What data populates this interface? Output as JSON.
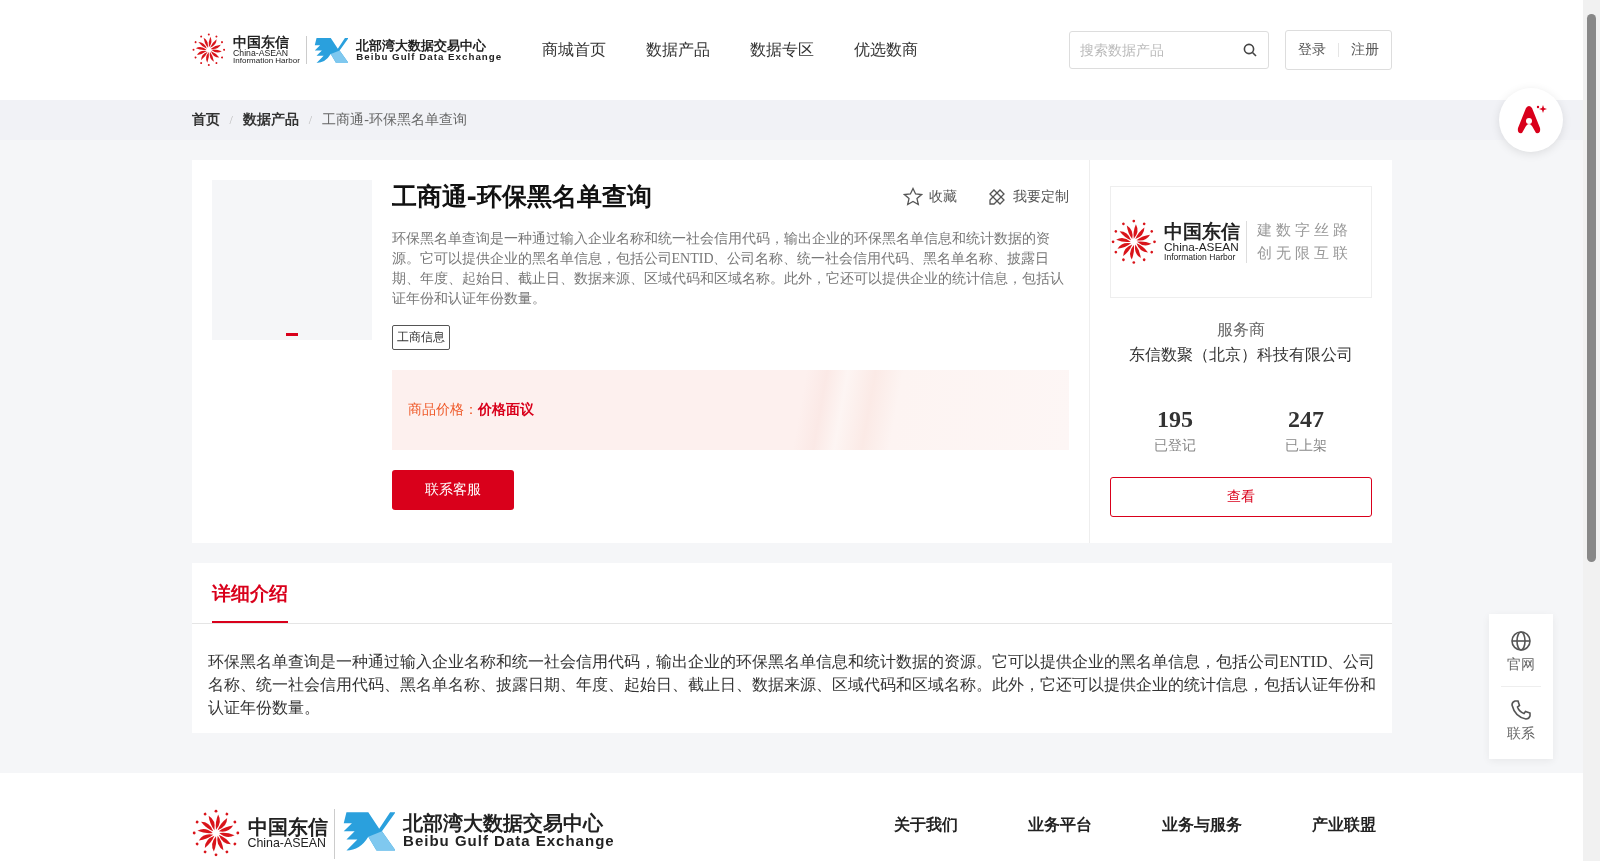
{
  "header": {
    "brand": {
      "cn": "中国东信",
      "en": "China-ASEAN",
      "en2": "Information Harbor"
    },
    "exchange": {
      "cn": "北部湾大数据交易中心",
      "en": "Beibu Gulf Data Exchange"
    },
    "nav": [
      {
        "label": "商城首页",
        "selected": false
      },
      {
        "label": "数据产品",
        "selected": false
      },
      {
        "label": "数据专区",
        "selected": false
      },
      {
        "label": "优选数商",
        "selected": false
      }
    ],
    "search": {
      "placeholder": "搜索数据产品"
    },
    "auth": [
      "登录",
      "注册"
    ]
  },
  "breadcrumb": {
    "separator": "/",
    "items": [
      "首页",
      "数据产品",
      "工商通-环保黑名单查询"
    ]
  },
  "product": {
    "carousel_dots": [
      {
        "selected": true
      }
    ],
    "title": "工商通-环保黑名单查询",
    "actions": [
      {
        "kind": "star",
        "label": "收藏"
      },
      {
        "kind": "custom",
        "label": "我要定制"
      }
    ],
    "description": "环保黑名单查询是一种通过输入企业名称和统一社会信用代码，输出企业的环保黑名单信息和统计数据的资源。它可以提供企业的黑名单信息，包括公司ENTID、公司名称、统一社会信用代码、黑名单名称、披露日期、年度、起始日、截止日、数据来源、区域代码和区域名称。此外，它还可以提供企业的统计信息，包括认证年份和认证年份数量。",
    "tags": [
      "工商信息"
    ],
    "price_label": "商品价格：",
    "price": "价格面议",
    "contact_button": "联系客服"
  },
  "provider": {
    "logo": {
      "cn": "中国东信",
      "en": "China-ASEAN",
      "en2": "Information Harbor",
      "slogan": [
        "建数字丝路",
        "创无限互联"
      ]
    },
    "label": "服务商",
    "name": "东信数聚（北京）科技有限公司",
    "stats": [
      {
        "value": "195",
        "label": "已登记"
      },
      {
        "value": "247",
        "label": "已上架"
      }
    ],
    "view_button": "查看"
  },
  "details": {
    "tabs": [
      {
        "label": "详细介绍",
        "selected": true
      }
    ],
    "text": "环保黑名单查询是一种通过输入企业名称和统一社会信用代码，输出企业的环保黑名单信息和统计数据的资源。它可以提供企业的黑名单信息，包括公司ENTID、公司名称、统一社会信用代码、黑名单名称、披露日期、年度、起始日、截止日、数据来源、区域代码和区域名称。此外，它还可以提供企业的统计信息，包括认证年份和认证年份数量。"
  },
  "side_panel": [
    {
      "kind": "globe",
      "label": "官网"
    },
    {
      "kind": "phone",
      "label": "联系"
    }
  ],
  "footer": {
    "brand": {
      "cn": "中国东信",
      "en": "China-ASEAN"
    },
    "exchange": {
      "cn": "北部湾大数据交易中心",
      "en": "Beibu Gulf Data Exchange"
    },
    "links": [
      "关于我们",
      "业务平台",
      "业务与服务",
      "产业联盟"
    ]
  }
}
